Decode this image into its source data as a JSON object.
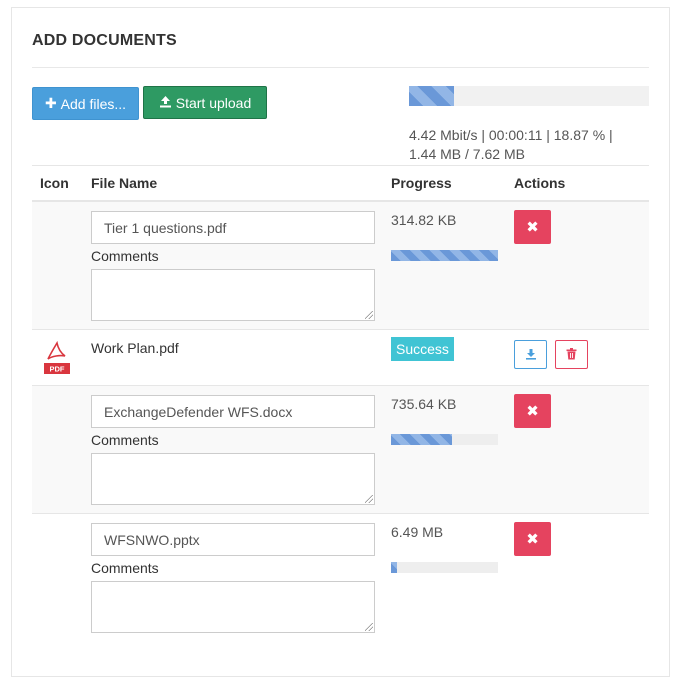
{
  "header": {
    "title": "ADD DOCUMENTS"
  },
  "toolbar": {
    "add_files_label": "Add files...",
    "add_files_icon": "plus-icon",
    "start_upload_label": "Start upload",
    "start_upload_icon": "upload-icon",
    "overall_progress_percent": 18.87,
    "stats_line1": "4.42 Mbit/s | 00:00:11 | 18.87 % |",
    "stats_line2": "1.44 MB / 7.62 MB"
  },
  "table": {
    "columns": [
      "Icon",
      "File Name",
      "Progress",
      "Actions"
    ],
    "comments_label": "Comments",
    "rows": [
      {
        "name": "Tier 1 questions.pdf",
        "size": "314.82 KB",
        "progress_percent": 100,
        "state": "uploading"
      },
      {
        "name": "Work Plan.pdf",
        "status": "Success",
        "icon": "pdf-file-icon",
        "state": "done",
        "icon_label": "PDF"
      },
      {
        "name": "ExchangeDefender WFS.docx",
        "size": "735.64 KB",
        "progress_percent": 57,
        "state": "uploading"
      },
      {
        "name": "WFSNWO.pptx",
        "size": "6.49 MB",
        "progress_percent": 6,
        "state": "uploading"
      }
    ]
  },
  "colors": {
    "add_button": "#4a9fdc",
    "start_button": "#2e9a63",
    "cancel_button": "#e5435f",
    "success_badge": "#40c4d4",
    "progress_fill": "#6a98d8"
  }
}
